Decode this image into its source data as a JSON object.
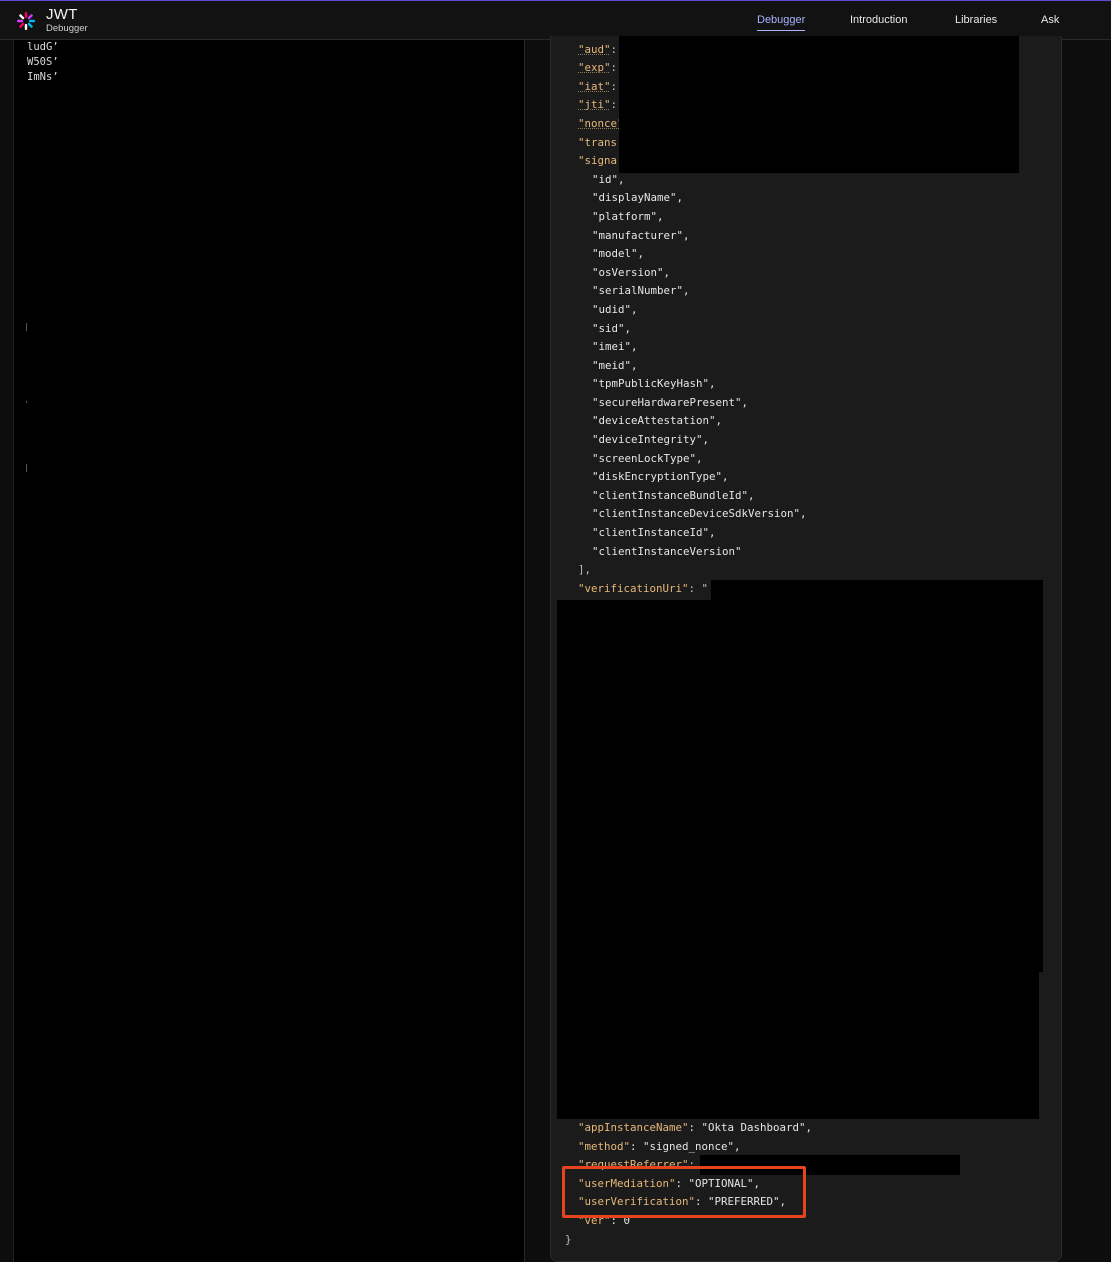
{
  "header": {
    "brand_title": "JWT",
    "brand_subtitle": "Debugger",
    "nav": [
      {
        "label": "Debugger",
        "active": true
      },
      {
        "label": "Introduction",
        "active": false
      },
      {
        "label": "Libraries",
        "active": false
      },
      {
        "label": "Ask",
        "active": false
      }
    ]
  },
  "encoded_token_lines": [
    "ludG’",
    "W50S’",
    "ImNs’"
  ],
  "payload": {
    "claim_keys": [
      "\"aud\"",
      "\"exp\"",
      "\"iat\"",
      "\"jti\"",
      "\"nonce\"",
      "\"trans",
      "\"signa"
    ],
    "claim_colons": [
      ":",
      ":",
      ":",
      ":",
      "",
      "",
      ""
    ],
    "signal_items": [
      "\"id\",",
      "\"displayName\",",
      "\"platform\",",
      "\"manufacturer\",",
      "\"model\",",
      "\"osVersion\",",
      "\"serialNumber\",",
      "\"udid\",",
      "\"sid\",",
      "\"imei\",",
      "\"meid\",",
      "\"tpmPublicKeyHash\",",
      "\"secureHardwarePresent\",",
      "\"deviceAttestation\",",
      "\"deviceIntegrity\",",
      "\"screenLockType\",",
      "\"diskEncryptionType\",",
      "\"clientInstanceBundleId\",",
      "\"clientInstanceDeviceSdkVersion\",",
      "\"clientInstanceId\",",
      "\"clientInstanceVersion\""
    ],
    "array_close": "],",
    "verification_uri_key": "\"verificationUri\"",
    "verification_uri_sep": ": \"",
    "app_instance_name_key": "\"appInstanceName\"",
    "app_instance_name_value": ": \"Okta Dashboard\",",
    "method_key": "\"method\"",
    "method_value": ": \"signed_nonce\",",
    "request_referrer_key": "\"requestReferrer\"",
    "request_referrer_sep": ":",
    "user_mediation_key": "\"userMediation\"",
    "user_mediation_value": ": \"OPTIONAL\",",
    "user_verification_key": "\"userVerification\"",
    "user_verification_value": ": \"PREFERRED\",",
    "ver_key": "\"ver\"",
    "ver_value": ": 0",
    "object_close": "}"
  },
  "colors": {
    "accent": "#a9b3ff",
    "key": "#e8b87a",
    "highlight": "#e8431f"
  }
}
